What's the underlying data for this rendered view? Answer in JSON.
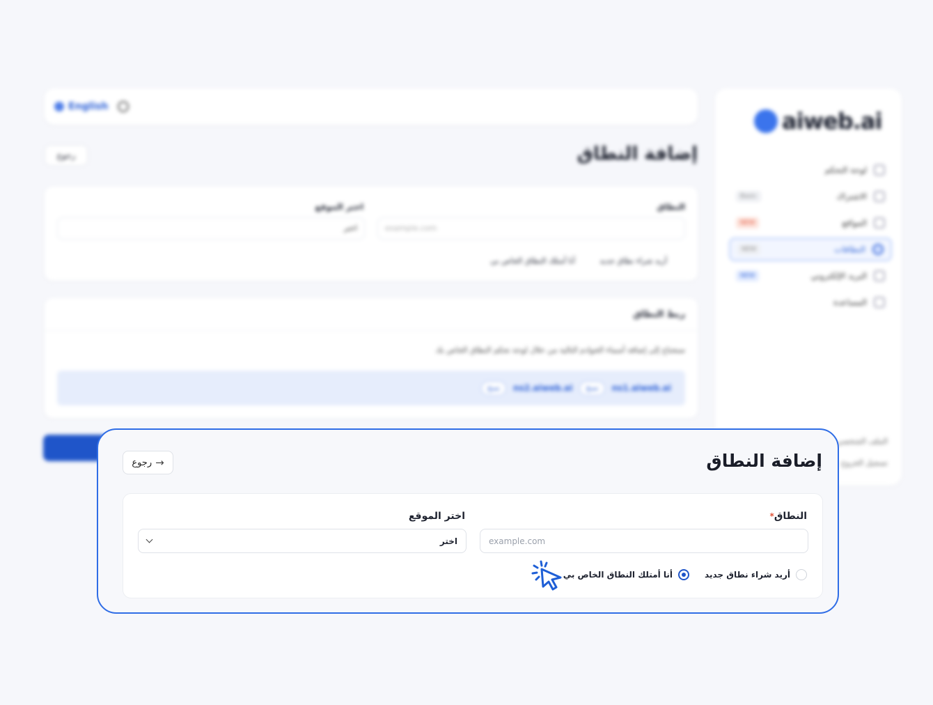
{
  "app": {
    "logo_text": "aiweb.ai",
    "language": "English"
  },
  "sidebar": {
    "items": [
      {
        "label": "لوحة التحكم",
        "badge": "",
        "icon": "home-icon"
      },
      {
        "label": "الاشتراك",
        "badge": "Basic",
        "icon": "card-icon"
      },
      {
        "label": "المواقع",
        "badge": "NEW",
        "icon": "sites-icon"
      },
      {
        "label": "النطاقات",
        "badge": "NEW",
        "icon": "globe-icon",
        "active": true
      },
      {
        "label": "البريد الإلكتروني",
        "badge": "NEW",
        "icon": "mail-icon"
      },
      {
        "label": "المساعدة",
        "badge": "",
        "icon": "help-icon"
      }
    ],
    "footer": [
      "الملف الشخصي",
      "تسجيل الخروج"
    ]
  },
  "background": {
    "title": "إضافة النطاق",
    "back_label": "رجوع",
    "domain_label": "النطاق",
    "domain_placeholder": "example.com",
    "site_label": "اختر الموقع",
    "site_value": "اختر",
    "radio_buy": "أريد شراء نطاق جديد",
    "radio_own": "أنا أمتلك النطاق الخاص بي",
    "connect_title": "ربط النطاق",
    "connect_text": "ستحتاج إلى إضافة أسماء الخوادم التالية من خلال لوحة تحكم النطاق الخاص بك",
    "ns1": "ns1.aiweb.ai",
    "ns2": "ns2.aiweb.ai",
    "copy_label": "نسخ"
  },
  "focus": {
    "title": "إضافة النطاق",
    "back_label": "رجوع",
    "domain_label": "النطاق",
    "required_mark": "*",
    "domain_placeholder": "example.com",
    "site_label": "اختر الموقع",
    "site_value": "اختر",
    "radio_buy": "أريد شراء نطاق جديد",
    "radio_own": "أنا أمتلك النطاق الخاص بي",
    "selected_option": "own"
  },
  "colors": {
    "accent": "#2f6de6",
    "primary_button": "#1f55c9",
    "required": "#e0553b"
  }
}
